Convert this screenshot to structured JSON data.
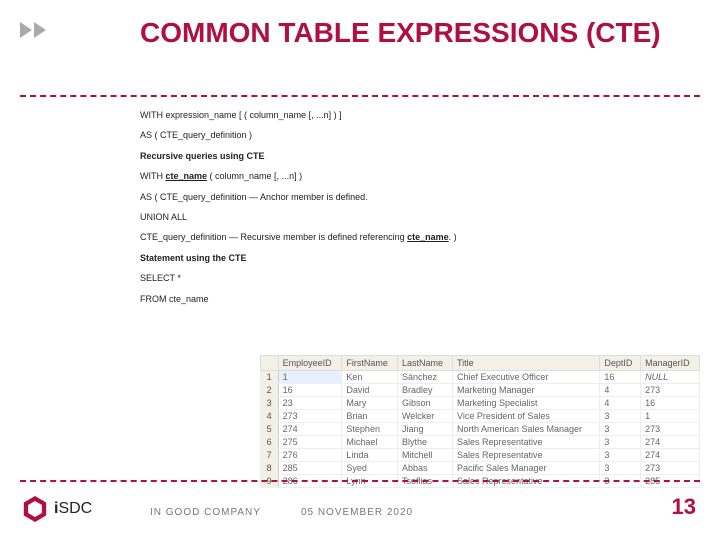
{
  "title": "COMMON TABLE EXPRESSIONS (CTE)",
  "lines": {
    "l1a": "WITH expression_name [ ( column_name [, ...n] ) ]",
    "l2a": "AS  ( CTE_query_definition )",
    "l3a": "Recursive queries using CTE",
    "l4a": "WITH ",
    "l4b": "cte_name",
    "l4c": " ( column_name [, ...n] )",
    "l5a": "AS ( CTE_query_definition — Anchor member is defined.",
    "l6a": "UNION ALL",
    "l7a": "CTE_query_definition — Recursive member is defined referencing ",
    "l7b": "cte_name",
    "l7c": ". )",
    "l8a": "Statement using the CTE",
    "l9a": "SELECT *",
    "l10a": "FROM cte_name"
  },
  "table": {
    "headers": [
      "",
      "EmployeeID",
      "FirstName",
      "LastName",
      "Title",
      "DeptID",
      "ManagerID"
    ],
    "rows": [
      [
        "1",
        "1",
        "Ken",
        "Sánchez",
        "Chief Executive Officer",
        "16",
        "NULL"
      ],
      [
        "2",
        "16",
        "David",
        "Bradley",
        "Marketing Manager",
        "4",
        "273"
      ],
      [
        "3",
        "23",
        "Mary",
        "Gibson",
        "Marketing Specialist",
        "4",
        "16"
      ],
      [
        "4",
        "273",
        "Brian",
        "Welcker",
        "Vice President of Sales",
        "3",
        "1"
      ],
      [
        "5",
        "274",
        "Stephen",
        "Jiang",
        "North American Sales Manager",
        "3",
        "273"
      ],
      [
        "6",
        "275",
        "Michael",
        "Blythe",
        "Sales Representative",
        "3",
        "274"
      ],
      [
        "7",
        "276",
        "Linda",
        "Mitchell",
        "Sales Representative",
        "3",
        "274"
      ],
      [
        "8",
        "285",
        "Syed",
        "Abbas",
        "Pacific Sales Manager",
        "3",
        "273"
      ],
      [
        "9",
        "286",
        "Lynn",
        "Tsoflias",
        "Sales Representative",
        "3",
        "285"
      ]
    ]
  },
  "footer": {
    "brand_i": "i",
    "brand_rest": "SDC",
    "tag": "IN GOOD COMPANY",
    "date": "05 NOVEMBER 2020",
    "page": "13"
  }
}
